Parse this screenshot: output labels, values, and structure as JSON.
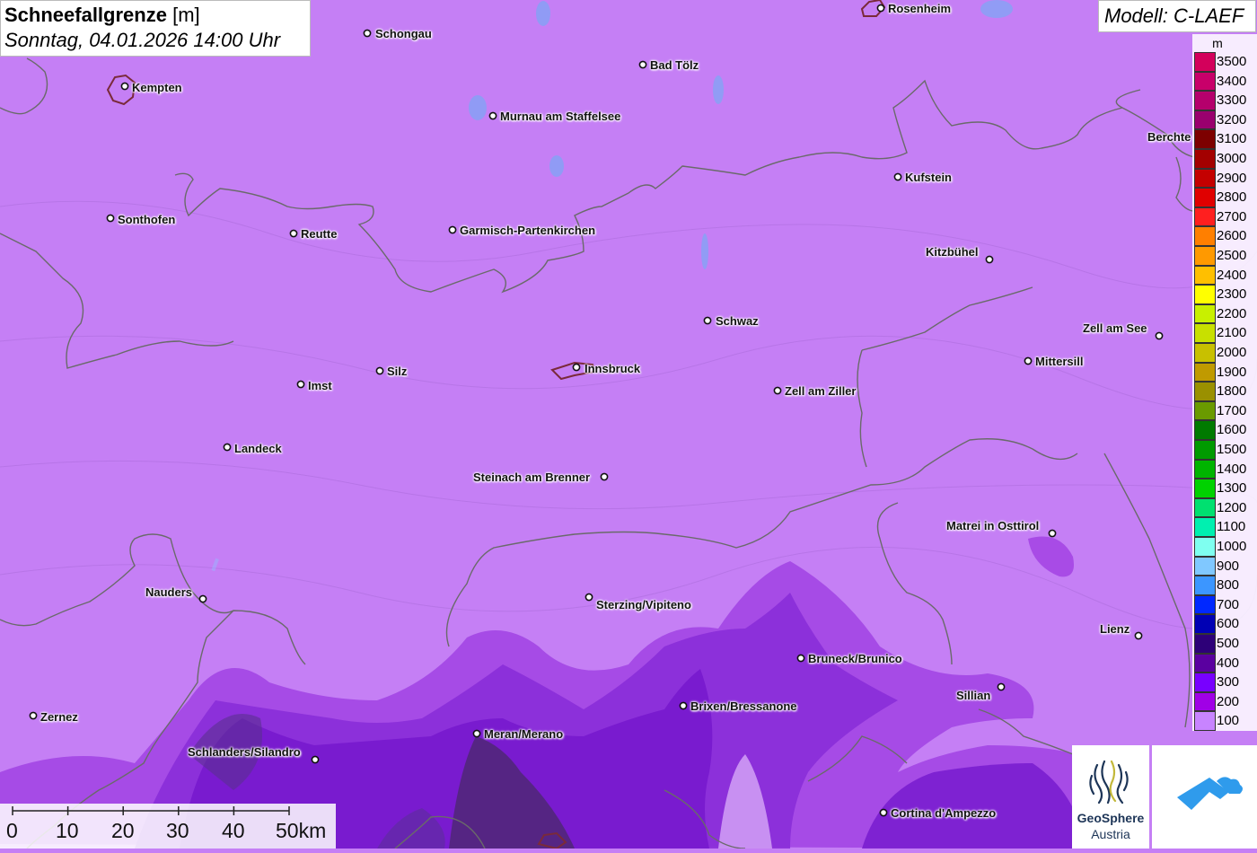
{
  "title": {
    "param": "Schneefallgrenze",
    "unit": "[m]",
    "datetime": "Sonntag, 04.01.2026 14:00 Uhr"
  },
  "model": "Modell: C-LAEF",
  "legend": {
    "unit": "m",
    "entries": [
      {
        "value": "3500",
        "color": "#d3005b"
      },
      {
        "value": "3400",
        "color": "#c8006a"
      },
      {
        "value": "3300",
        "color": "#b5006c"
      },
      {
        "value": "3200",
        "color": "#9a006e"
      },
      {
        "value": "3100",
        "color": "#7d0000"
      },
      {
        "value": "3000",
        "color": "#a30000"
      },
      {
        "value": "2900",
        "color": "#c40000"
      },
      {
        "value": "2800",
        "color": "#e00000"
      },
      {
        "value": "2700",
        "color": "#ff1f1f"
      },
      {
        "value": "2600",
        "color": "#ff7f00"
      },
      {
        "value": "2500",
        "color": "#ff9900"
      },
      {
        "value": "2400",
        "color": "#ffbf00"
      },
      {
        "value": "2300",
        "color": "#ffff00"
      },
      {
        "value": "2200",
        "color": "#c8f000"
      },
      {
        "value": "2100",
        "color": "#c8e000"
      },
      {
        "value": "2000",
        "color": "#c8c000"
      },
      {
        "value": "1900",
        "color": "#c09a00"
      },
      {
        "value": "1800",
        "color": "#9a9000"
      },
      {
        "value": "1700",
        "color": "#6a9a00"
      },
      {
        "value": "1600",
        "color": "#007a00"
      },
      {
        "value": "1500",
        "color": "#009a00"
      },
      {
        "value": "1400",
        "color": "#00b400"
      },
      {
        "value": "1300",
        "color": "#00d200"
      },
      {
        "value": "1200",
        "color": "#00e070"
      },
      {
        "value": "1100",
        "color": "#00f0b0"
      },
      {
        "value": "1000",
        "color": "#7ffff0"
      },
      {
        "value": "900",
        "color": "#80c8ff"
      },
      {
        "value": "800",
        "color": "#3c96ff"
      },
      {
        "value": "700",
        "color": "#0028ff"
      },
      {
        "value": "600",
        "color": "#0000b4"
      },
      {
        "value": "500",
        "color": "#2d0078"
      },
      {
        "value": "400",
        "color": "#5a00a0"
      },
      {
        "value": "300",
        "color": "#7800ff"
      },
      {
        "value": "200",
        "color": "#a000e6"
      },
      {
        "value": "100",
        "color": "#c884ff"
      }
    ]
  },
  "cities": [
    {
      "name": "Schongau"
    },
    {
      "name": "Rosenheim"
    },
    {
      "name": "Bad Tölz"
    },
    {
      "name": "Kempten"
    },
    {
      "name": "Murnau am Staffelsee"
    },
    {
      "name": "Berchte"
    },
    {
      "name": "Kufstein"
    },
    {
      "name": "Sonthofen"
    },
    {
      "name": "Reutte"
    },
    {
      "name": "Garmisch-Partenkirchen"
    },
    {
      "name": "Kitzbühel"
    },
    {
      "name": "Schwaz"
    },
    {
      "name": "Zell am See"
    },
    {
      "name": "Mittersill"
    },
    {
      "name": "Silz"
    },
    {
      "name": "Innsbruck"
    },
    {
      "name": "Imst"
    },
    {
      "name": "Zell am Ziller"
    },
    {
      "name": "Landeck"
    },
    {
      "name": "Steinach am Brenner"
    },
    {
      "name": "Matrei in Osttirol"
    },
    {
      "name": "Nauders"
    },
    {
      "name": "Sterzing/Vipiteno"
    },
    {
      "name": "Lienz"
    },
    {
      "name": "Bruneck/Brunico"
    },
    {
      "name": "Sillian"
    },
    {
      "name": "Brixen/Bressanone"
    },
    {
      "name": "Zernez"
    },
    {
      "name": "Meran/Merano"
    },
    {
      "name": "Schlanders/Silandro"
    },
    {
      "name": "Cortina d'Ampezzo"
    }
  ],
  "scale": {
    "labels": [
      "0",
      "10",
      "20",
      "30",
      "40",
      "50km"
    ]
  },
  "logos": {
    "geosphere_name": "GeoSphere",
    "geosphere_sub": "Austria"
  }
}
